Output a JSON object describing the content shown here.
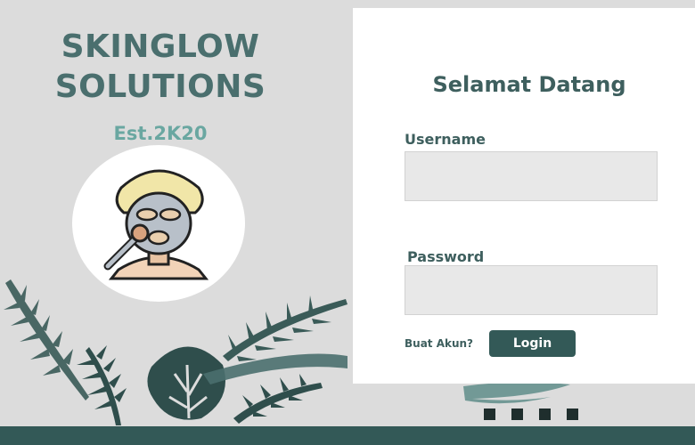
{
  "brand": {
    "title_line1": "SKINGLOW",
    "title_line2": "SOLUTIONS",
    "established": "Est.2K20",
    "logo_icon": "face-mask-icon"
  },
  "login": {
    "heading": "Selamat Datang",
    "username_label": "Username",
    "username_value": "",
    "password_label": "Password",
    "password_value": "",
    "create_account_link": "Buat Akun?",
    "login_button": "Login"
  },
  "colors": {
    "primary": "#335957",
    "heading": "#3e5f5e",
    "accent": "#6aa7a1",
    "background": "#dcdcdc",
    "input_bg": "#e8e8e8"
  }
}
